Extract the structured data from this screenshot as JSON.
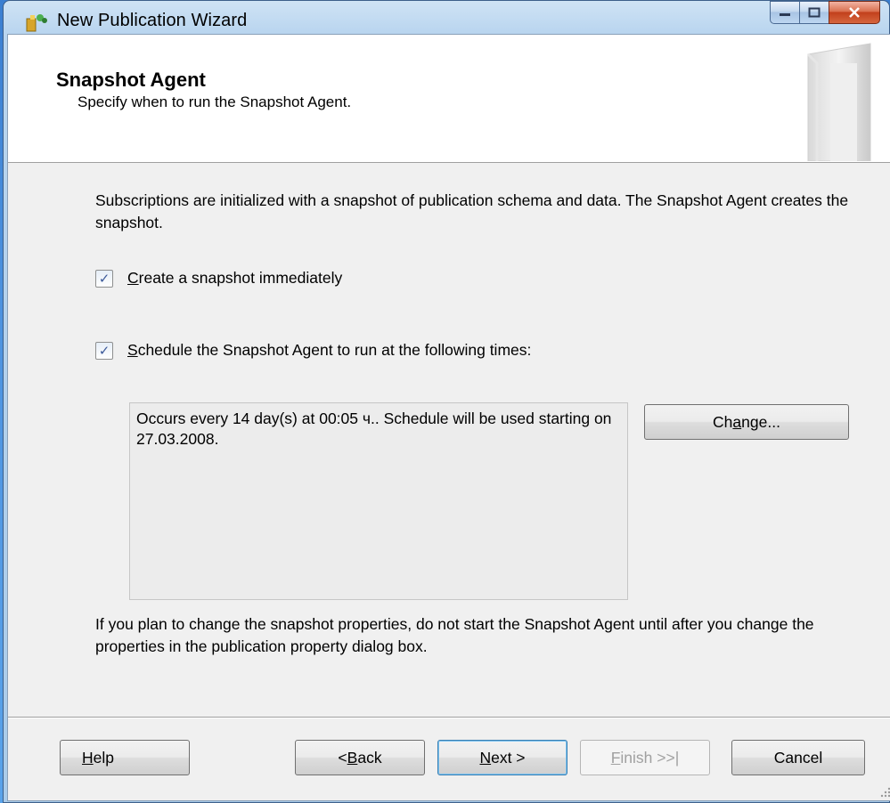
{
  "window": {
    "title": "New Publication Wizard"
  },
  "header": {
    "title": "Snapshot Agent",
    "subtitle": "Specify when to run the Snapshot Agent."
  },
  "intro_text": "Subscriptions are initialized with a snapshot of publication schema and data. The Snapshot Agent creates the snapshot.",
  "options": {
    "create_snapshot": {
      "label_accel": "C",
      "label_rest": "reate a snapshot immediately",
      "checked": true
    },
    "schedule_agent": {
      "label_accel": "S",
      "label_rest": "chedule the Snapshot Agent to run at the following times:",
      "checked": true
    }
  },
  "schedule": {
    "description": "Occurs every 14 day(s) at 00:05 ч.. Schedule will be used starting on 27.03.2008.",
    "change_pre": "Ch",
    "change_accel": "a",
    "change_post": "nge..."
  },
  "outro_text": "If you plan to change the snapshot properties, do not start the Snapshot Agent until after you change the properties in the publication property dialog box.",
  "buttons": {
    "help_accel": "H",
    "help_rest": "elp",
    "back_pre": "< ",
    "back_accel": "B",
    "back_rest": "ack",
    "next_accel": "N",
    "next_rest": "ext >",
    "finish_accel": "F",
    "finish_rest": "inish >>|",
    "cancel": "Cancel"
  },
  "icons": {
    "app": "wizard-app-icon",
    "minimize": "minimize-icon",
    "maximize": "maximize-icon",
    "close": "close-icon",
    "header": "publication-book-graphic",
    "check": "checkmark-icon"
  }
}
